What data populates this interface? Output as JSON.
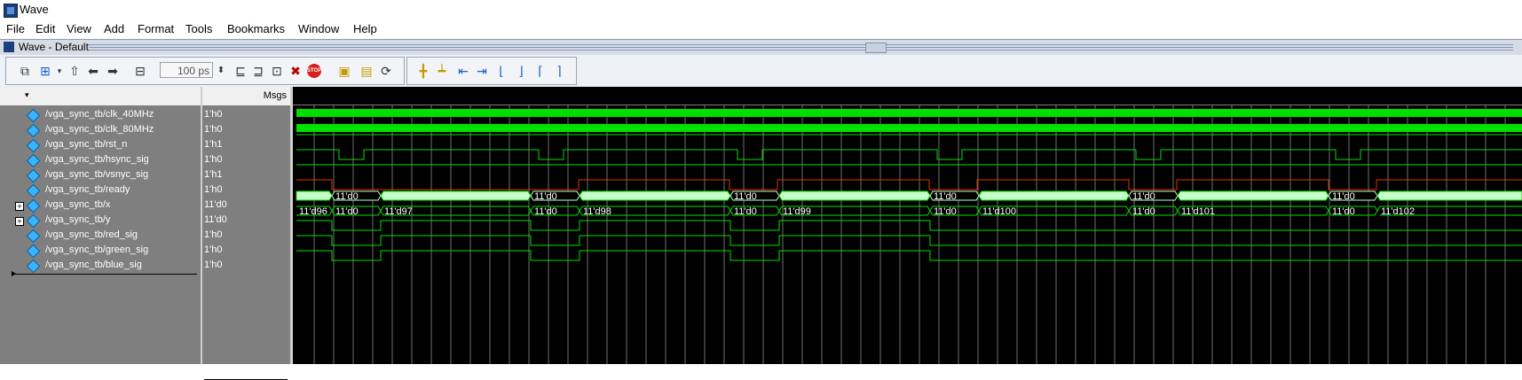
{
  "window": {
    "title": "Wave"
  },
  "menu": [
    "File",
    "Edit",
    "View",
    "Add",
    "Format",
    "Tools",
    "Bookmarks",
    "Window",
    "Help"
  ],
  "pane": {
    "title": "Wave - Default",
    "msgs_header": "Msgs"
  },
  "toolbar": {
    "zoom_value": "100 ps"
  },
  "icons": {
    "toolbar": [
      "new-window-icon",
      "find-icon",
      "up-arrow-icon",
      "left-arrow-icon",
      "right-arrow-icon",
      "zoom-field-icon",
      "step-icon",
      "step-over-icon",
      "step-into-icon",
      "restart-icon",
      "stop-icon",
      "run-icon",
      "run-all-icon",
      "break-icon",
      "add-cursor-icon",
      "delete-cursor-icon",
      "prev-edge-icon",
      "next-edge-icon",
      "find-edge-1-icon",
      "find-edge-2-icon",
      "find-edge-3-icon",
      "find-edge-4-icon"
    ]
  },
  "colors": {
    "wave_bg": "#000000",
    "signal_green": "#00e000",
    "bus_fill": "#c8ffc8",
    "ready_red": "#e03000",
    "grid": "#6f6f6f"
  },
  "signals": [
    {
      "name": "/vga_sync_tb/clk_40MHz",
      "value": "1'h0",
      "expandable": false
    },
    {
      "name": "/vga_sync_tb/clk_80MHz",
      "value": "1'h0",
      "expandable": false
    },
    {
      "name": "/vga_sync_tb/rst_n",
      "value": "1'h1",
      "expandable": false
    },
    {
      "name": "/vga_sync_tb/hsync_sig",
      "value": "1'h0",
      "expandable": false
    },
    {
      "name": "/vga_sync_tb/vsnyc_sig",
      "value": "1'h1",
      "expandable": false
    },
    {
      "name": "/vga_sync_tb/ready",
      "value": "1'h0",
      "expandable": false
    },
    {
      "name": "/vga_sync_tb/x",
      "value": "11'd0",
      "expandable": true
    },
    {
      "name": "/vga_sync_tb/y",
      "value": "11'd0",
      "expandable": true
    },
    {
      "name": "/vga_sync_tb/red_sig",
      "value": "1'h0",
      "expandable": false
    },
    {
      "name": "/vga_sync_tb/green_sig",
      "value": "1'h0",
      "expandable": false
    },
    {
      "name": "/vga_sync_tb/blue_sig",
      "value": "1'h0",
      "expandable": false
    }
  ],
  "waves": {
    "x_labels": [
      "11'd0",
      "11'd0",
      "11'd0",
      "11'd0",
      "11'd0",
      "11'd0"
    ],
    "y_labels": [
      "11'd96",
      "11'd0",
      "11'd97",
      "11'd0",
      "11'd98",
      "11'd0",
      "11'd99",
      "11'd0",
      "11'd100",
      "11'd0",
      "11'd101",
      "11'd0",
      "11'd102"
    ]
  }
}
